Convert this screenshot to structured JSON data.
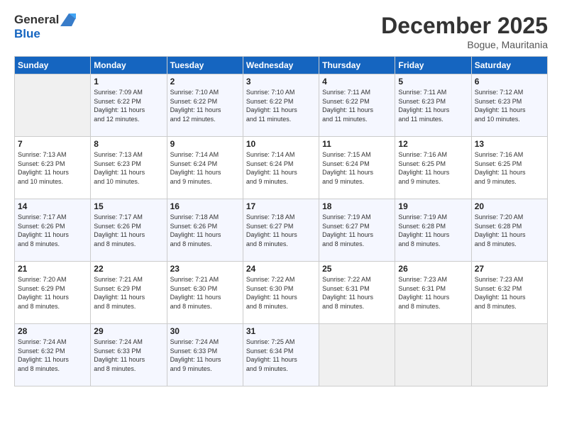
{
  "logo": {
    "line1": "General",
    "line2": "Blue"
  },
  "title": "December 2025",
  "subtitle": "Bogue, Mauritania",
  "days_header": [
    "Sunday",
    "Monday",
    "Tuesday",
    "Wednesday",
    "Thursday",
    "Friday",
    "Saturday"
  ],
  "weeks": [
    [
      {
        "num": "",
        "info": ""
      },
      {
        "num": "1",
        "info": "Sunrise: 7:09 AM\nSunset: 6:22 PM\nDaylight: 11 hours\nand 12 minutes."
      },
      {
        "num": "2",
        "info": "Sunrise: 7:10 AM\nSunset: 6:22 PM\nDaylight: 11 hours\nand 12 minutes."
      },
      {
        "num": "3",
        "info": "Sunrise: 7:10 AM\nSunset: 6:22 PM\nDaylight: 11 hours\nand 11 minutes."
      },
      {
        "num": "4",
        "info": "Sunrise: 7:11 AM\nSunset: 6:22 PM\nDaylight: 11 hours\nand 11 minutes."
      },
      {
        "num": "5",
        "info": "Sunrise: 7:11 AM\nSunset: 6:23 PM\nDaylight: 11 hours\nand 11 minutes."
      },
      {
        "num": "6",
        "info": "Sunrise: 7:12 AM\nSunset: 6:23 PM\nDaylight: 11 hours\nand 10 minutes."
      }
    ],
    [
      {
        "num": "7",
        "info": "Sunrise: 7:13 AM\nSunset: 6:23 PM\nDaylight: 11 hours\nand 10 minutes."
      },
      {
        "num": "8",
        "info": "Sunrise: 7:13 AM\nSunset: 6:23 PM\nDaylight: 11 hours\nand 10 minutes."
      },
      {
        "num": "9",
        "info": "Sunrise: 7:14 AM\nSunset: 6:24 PM\nDaylight: 11 hours\nand 9 minutes."
      },
      {
        "num": "10",
        "info": "Sunrise: 7:14 AM\nSunset: 6:24 PM\nDaylight: 11 hours\nand 9 minutes."
      },
      {
        "num": "11",
        "info": "Sunrise: 7:15 AM\nSunset: 6:24 PM\nDaylight: 11 hours\nand 9 minutes."
      },
      {
        "num": "12",
        "info": "Sunrise: 7:16 AM\nSunset: 6:25 PM\nDaylight: 11 hours\nand 9 minutes."
      },
      {
        "num": "13",
        "info": "Sunrise: 7:16 AM\nSunset: 6:25 PM\nDaylight: 11 hours\nand 9 minutes."
      }
    ],
    [
      {
        "num": "14",
        "info": "Sunrise: 7:17 AM\nSunset: 6:26 PM\nDaylight: 11 hours\nand 8 minutes."
      },
      {
        "num": "15",
        "info": "Sunrise: 7:17 AM\nSunset: 6:26 PM\nDaylight: 11 hours\nand 8 minutes."
      },
      {
        "num": "16",
        "info": "Sunrise: 7:18 AM\nSunset: 6:26 PM\nDaylight: 11 hours\nand 8 minutes."
      },
      {
        "num": "17",
        "info": "Sunrise: 7:18 AM\nSunset: 6:27 PM\nDaylight: 11 hours\nand 8 minutes."
      },
      {
        "num": "18",
        "info": "Sunrise: 7:19 AM\nSunset: 6:27 PM\nDaylight: 11 hours\nand 8 minutes."
      },
      {
        "num": "19",
        "info": "Sunrise: 7:19 AM\nSunset: 6:28 PM\nDaylight: 11 hours\nand 8 minutes."
      },
      {
        "num": "20",
        "info": "Sunrise: 7:20 AM\nSunset: 6:28 PM\nDaylight: 11 hours\nand 8 minutes."
      }
    ],
    [
      {
        "num": "21",
        "info": "Sunrise: 7:20 AM\nSunset: 6:29 PM\nDaylight: 11 hours\nand 8 minutes."
      },
      {
        "num": "22",
        "info": "Sunrise: 7:21 AM\nSunset: 6:29 PM\nDaylight: 11 hours\nand 8 minutes."
      },
      {
        "num": "23",
        "info": "Sunrise: 7:21 AM\nSunset: 6:30 PM\nDaylight: 11 hours\nand 8 minutes."
      },
      {
        "num": "24",
        "info": "Sunrise: 7:22 AM\nSunset: 6:30 PM\nDaylight: 11 hours\nand 8 minutes."
      },
      {
        "num": "25",
        "info": "Sunrise: 7:22 AM\nSunset: 6:31 PM\nDaylight: 11 hours\nand 8 minutes."
      },
      {
        "num": "26",
        "info": "Sunrise: 7:23 AM\nSunset: 6:31 PM\nDaylight: 11 hours\nand 8 minutes."
      },
      {
        "num": "27",
        "info": "Sunrise: 7:23 AM\nSunset: 6:32 PM\nDaylight: 11 hours\nand 8 minutes."
      }
    ],
    [
      {
        "num": "28",
        "info": "Sunrise: 7:24 AM\nSunset: 6:32 PM\nDaylight: 11 hours\nand 8 minutes."
      },
      {
        "num": "29",
        "info": "Sunrise: 7:24 AM\nSunset: 6:33 PM\nDaylight: 11 hours\nand 8 minutes."
      },
      {
        "num": "30",
        "info": "Sunrise: 7:24 AM\nSunset: 6:33 PM\nDaylight: 11 hours\nand 9 minutes."
      },
      {
        "num": "31",
        "info": "Sunrise: 7:25 AM\nSunset: 6:34 PM\nDaylight: 11 hours\nand 9 minutes."
      },
      {
        "num": "",
        "info": ""
      },
      {
        "num": "",
        "info": ""
      },
      {
        "num": "",
        "info": ""
      }
    ]
  ]
}
